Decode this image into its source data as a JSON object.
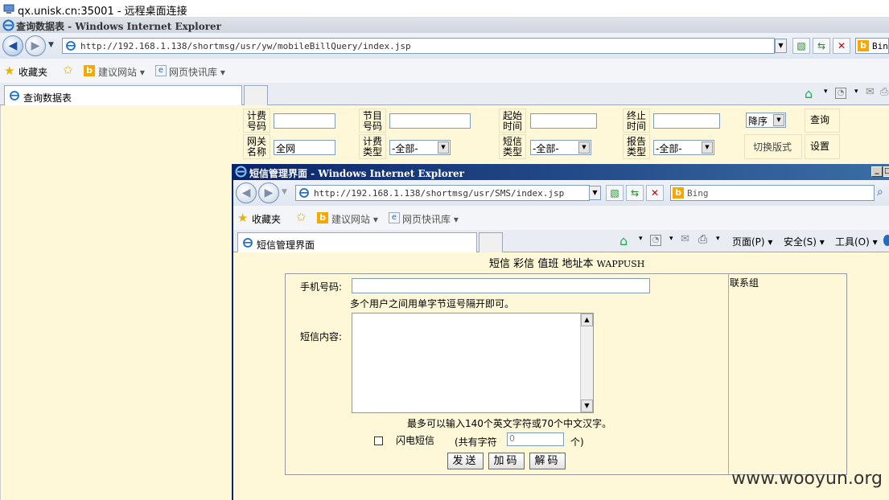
{
  "rdp": {
    "title": "qx.unisk.cn:35001 - 远程桌面连接"
  },
  "back_window": {
    "title": "查询数据表 - Windows Internet Explorer",
    "address": "http://192.168.1.138/shortmsg/usr/yw/mobileBillQuery/index.jsp",
    "search_text": "Bin",
    "favorites": {
      "label": "收藏夹",
      "suggested": "建议网站",
      "web_slice": "网页快讯库"
    },
    "tab_label": "查询数据表"
  },
  "query_form": {
    "row1": [
      {
        "label": "计费号码",
        "value": ""
      },
      {
        "label": "节目号码",
        "value": ""
      },
      {
        "label": "起始时间",
        "value": ""
      },
      {
        "label": "终止时间",
        "value": ""
      }
    ],
    "sort_value": "降序",
    "query_btn": "查询",
    "row2": [
      {
        "label": "网关名称",
        "value": "全网"
      },
      {
        "label": "计费类型",
        "value": "-全部-"
      },
      {
        "label": "短信类型",
        "value": "-全部-"
      },
      {
        "label": "报告类型",
        "value": "-全部-"
      }
    ],
    "switch_layout": "切换版式",
    "settings_btn": "设置"
  },
  "front_window": {
    "title": "短信管理界面 - Windows Internet Explorer",
    "address": "http://192.168.1.138/shortmsg/usr/SMS/index.jsp",
    "search_placeholder": "Bing",
    "favorites": {
      "label": "收藏夹",
      "suggested": "建议网站",
      "web_slice": "网页快讯库"
    },
    "tab_label": "短信管理界面",
    "cmd": {
      "page": "页面(P)",
      "safety": "安全(S)",
      "tools": "工具(O)"
    }
  },
  "sms_page": {
    "nav_links": [
      "短信",
      "彩信",
      "值班",
      "地址本",
      "WAPPUSH"
    ],
    "phone_label": "手机号码:",
    "phone_value": "",
    "phone_hint": "多个用户之间用单字节逗号隔开即可。",
    "content_label": "短信内容:",
    "content_value": "",
    "limit_hint": "最多可以输入140个英文字符或70个中文汉字。",
    "flash_label": "闪电短信",
    "count_prefix": "(共有字符",
    "count_value": "0",
    "count_suffix": "个)",
    "buttons": {
      "send": "发送",
      "encode": "加码",
      "decode": "解码"
    },
    "contacts_label": "联系组"
  },
  "watermark": "www.wooyun.org",
  "colors": {
    "page_bg": "#fff8d8",
    "titlebar_active": "#0a246a"
  }
}
